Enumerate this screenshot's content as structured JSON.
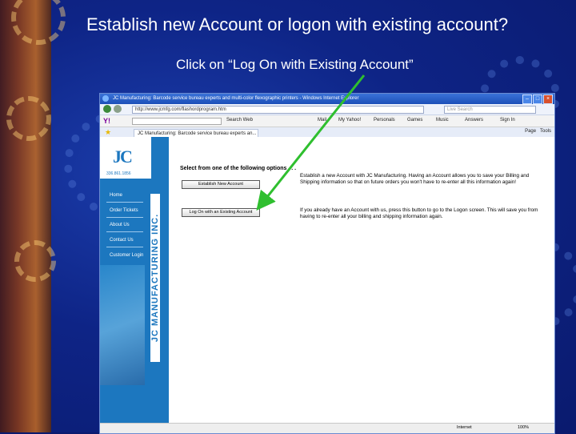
{
  "slide": {
    "title": "Establish new Account or logon with existing account?",
    "subtitle": "Click on “Log On with Existing Account”"
  },
  "browser": {
    "window_title": "JC Manufacturing: Barcode service bureau experts and multi-color flexographic printers - Windows Internet Explorer",
    "address": "http://www.jcmfg.com/flashordprogram.htm",
    "search_placeholder": "Live Search",
    "toolbar": {
      "search_web": "Search Web",
      "items": [
        "Mail",
        "My Yahoo!",
        "Personals",
        "Games",
        "Music",
        "Answers",
        "Sign In"
      ]
    },
    "tab_title": "JC Manufacturing: Barcode service bureau experts an...",
    "tab_tools": {
      "page": "Page",
      "tools": "Tools"
    },
    "status": {
      "zone": "Internet",
      "zoom": "100%"
    }
  },
  "site": {
    "logo": "JC",
    "phone": "336.861.1856",
    "brand_vertical": "JC MANUFACTURING INC.",
    "nav": [
      "Home",
      "Order Tickets",
      "About Us",
      "Contact Us",
      "Customer Login"
    ],
    "heading": "Select from one of the following options . . .",
    "options": [
      {
        "button": "Establish New Account",
        "description": "Establish a new Account with JC Manufacturing. Having an Account allows you to save your Billing and Shipping information so that on future orders you won't have to re-enter all this information again!"
      },
      {
        "button": "Log On with an Existing Account",
        "description": "If you already have an Account with us, press this button to go to the Logon screen. This will save you from having to re-enter all your billing and shipping information again."
      }
    ]
  },
  "colors": {
    "arrow": "#2fbf2f",
    "sidebar": "#1c77bf",
    "slide_bg": "#0e2486"
  }
}
